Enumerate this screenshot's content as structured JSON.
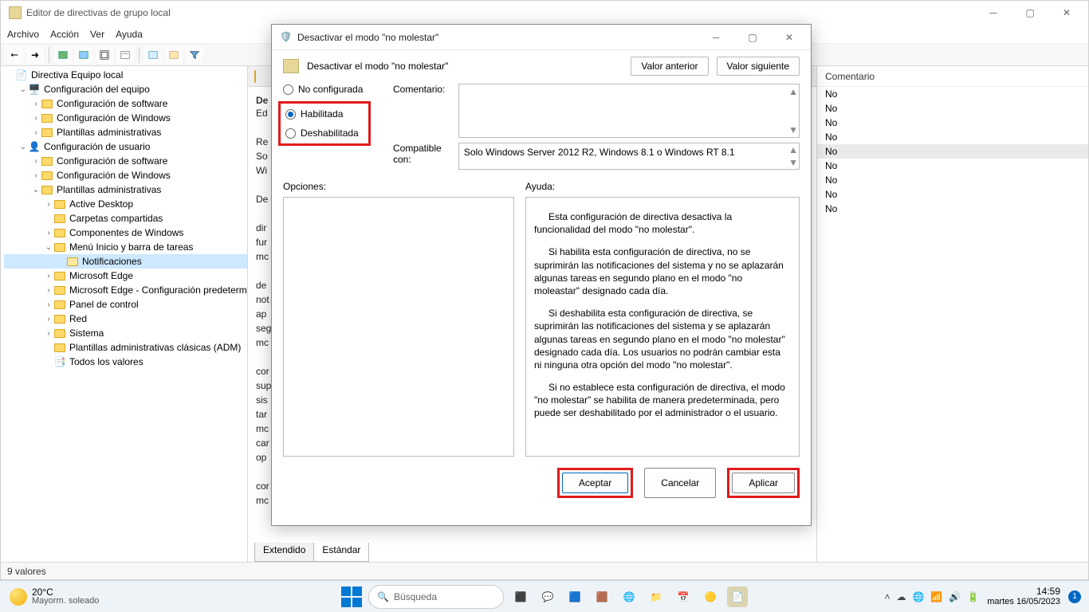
{
  "main_window": {
    "title": "Editor de directivas de grupo local",
    "menu": [
      "Archivo",
      "Acción",
      "Ver",
      "Ayuda"
    ],
    "statusbar": "9 valores"
  },
  "tree": {
    "root": "Directiva Equipo local",
    "cfg_equipo": "Configuración del equipo",
    "cfg_equipo_children": [
      "Configuración de software",
      "Configuración de Windows",
      "Plantillas administrativas"
    ],
    "cfg_usuario": "Configuración de usuario",
    "cfg_sw": "Configuración de software",
    "cfg_win": "Configuración de Windows",
    "plantillas": "Plantillas administrativas",
    "active_desktop": "Active Desktop",
    "carpetas": "Carpetas compartidas",
    "componentes": "Componentes de Windows",
    "menu_inicio": "Menú Inicio y barra de tareas",
    "notificaciones": "Notificaciones",
    "edge": "Microsoft Edge",
    "edge_cfg": "Microsoft Edge - Configuración predeterm",
    "panel_control": "Panel de control",
    "red": "Red",
    "sistema": "Sistema",
    "plantillas_adm": "Plantillas administrativas clásicas (ADM)",
    "todos": "Todos los valores"
  },
  "center": {
    "heading_prefix": "De",
    "tabs": {
      "extendido": "Extendido",
      "estandar": "Estándar"
    },
    "truncated_lines": [
      "Ed",
      "Re",
      "So",
      "Wi",
      "De",
      "dir",
      "fur",
      "mc",
      "de",
      "not",
      "ap",
      "seg",
      "mc",
      "cor",
      "sup",
      "sis",
      "tar",
      "mc",
      "car",
      "op",
      "cor",
      "mc"
    ]
  },
  "right_col": {
    "header": "Comentario",
    "values": [
      "No",
      "No",
      "No",
      "No",
      "No",
      "No",
      "No",
      "No",
      "No"
    ]
  },
  "dialog": {
    "window_title": "Desactivar el modo \"no molestar\"",
    "policy_title": "Desactivar el modo \"no molestar\"",
    "prev_btn": "Valor anterior",
    "next_btn": "Valor siguiente",
    "radio_not_configured": "No configurada",
    "radio_enabled": "Habilitada",
    "radio_disabled": "Deshabilitada",
    "comment_label": "Comentario:",
    "compat_label": "Compatible con:",
    "compat_text": "Solo Windows Server 2012 R2, Windows 8.1 o Windows RT 8.1",
    "options_label": "Opciones:",
    "help_label": "Ayuda:",
    "help_p1": "Esta configuración de directiva desactiva la funcionalidad del modo \"no molestar\".",
    "help_p2": "Si habilita esta configuración de directiva, no se suprimirán las notificaciones del sistema y no se aplazarán algunas tareas en segundo plano en el modo \"no moleastar\" designado cada día.",
    "help_p3": "Si deshabilita esta configuración de directiva, se suprimirán las notificaciones del sistema y se aplazarán algunas tareas en segundo plano en el modo \"no molestar\" designado cada día. Los usuarios no podrán cambiar esta ni ninguna otra opción del modo \"no molestar\".",
    "help_p4": "Si no establece esta configuración de directiva, el modo \"no molestar\" se habilita de manera predeterminada, pero puede ser deshabilitado por el administrador o el usuario.",
    "ok": "Aceptar",
    "cancel": "Cancelar",
    "apply": "Aplicar"
  },
  "taskbar": {
    "temp": "20°C",
    "weather": "Mayorm. soleado",
    "search_placeholder": "Búsqueda",
    "time": "14:59",
    "date": "martes 16/05/2023",
    "badge": "1"
  }
}
